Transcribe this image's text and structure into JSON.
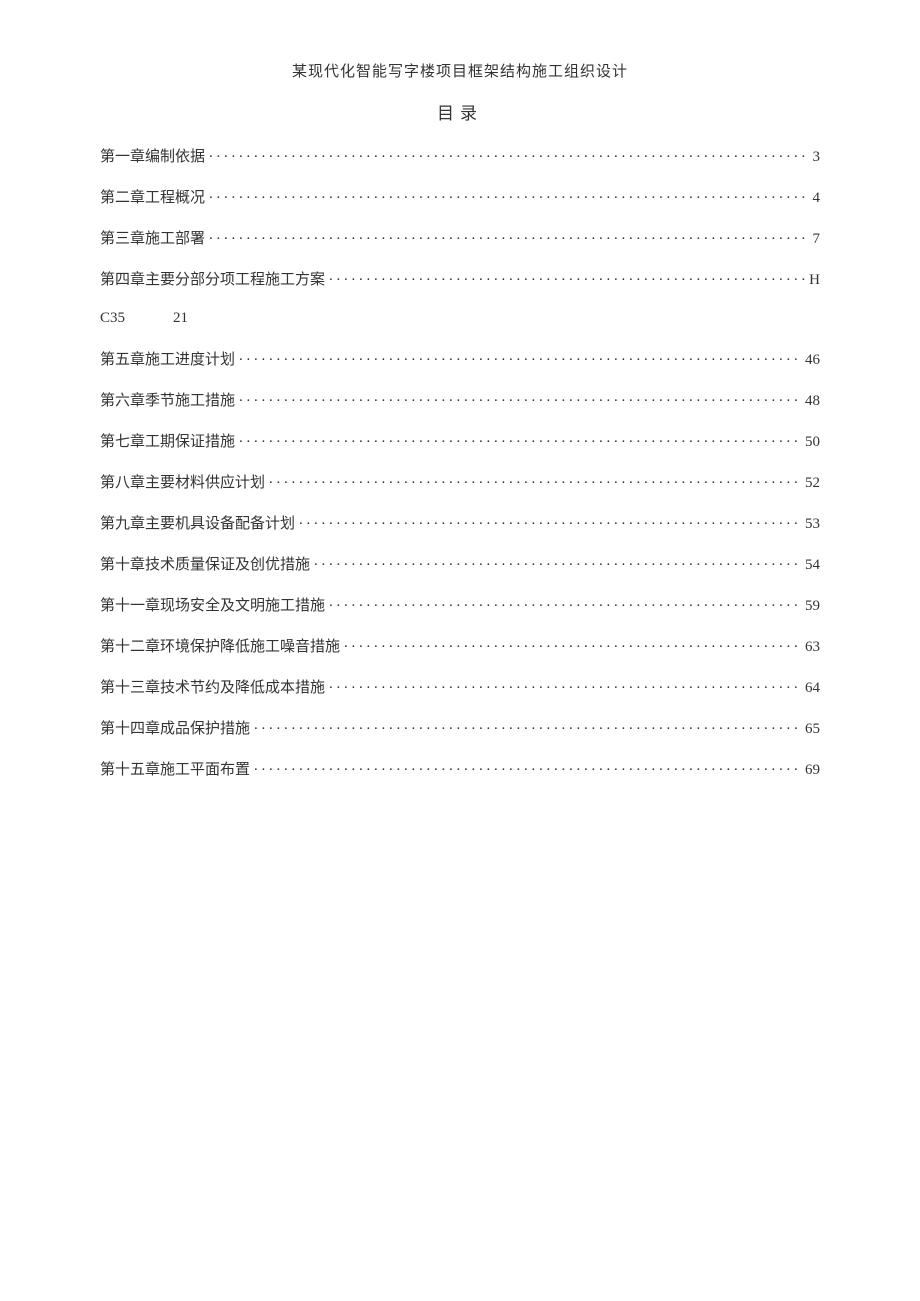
{
  "header_title": "某现代化智能写字楼项目框架结构施工组织设计",
  "toc_heading": "目录",
  "extra_row": {
    "left": "C35",
    "right": "21"
  },
  "items": [
    {
      "label": "第一章编制依据",
      "page": "3",
      "leader": true
    },
    {
      "label": "第二章工程概况",
      "page": "4",
      "leader": true
    },
    {
      "label": "第三章施工部署",
      "page": "7",
      "leader": true
    },
    {
      "label": "第四章主要分部分项工程施工方案 ",
      "page": "H",
      "leader": true
    },
    {
      "extra": true
    },
    {
      "label": "第五章施工进度计划",
      "page": "46",
      "leader": true
    },
    {
      "label": "第六章季节施工措施",
      "page": "48",
      "leader": true
    },
    {
      "label": "第七章工期保证措施",
      "page": "50",
      "leader": true
    },
    {
      "label": "第八章主要材料供应计划",
      "page": "52",
      "leader": true
    },
    {
      "label": "第九章主要机具设备配备计划",
      "page": "53",
      "leader": true
    },
    {
      "label": "第十章技术质量保证及创优措施",
      "page": "54",
      "leader": true
    },
    {
      "label": "第十一章现场安全及文明施工措施",
      "page": "59",
      "leader": true
    },
    {
      "label": "第十二章环境保护降低施工噪音措施",
      "page": "63",
      "leader": true
    },
    {
      "label": "第十三章技术节约及降低成本措施",
      "page": "64",
      "leader": true
    },
    {
      "label": "第十四章成品保护措施",
      "page": "65",
      "leader": true
    },
    {
      "label": "第十五章施工平面布置",
      "page": "69",
      "leader": true
    }
  ]
}
